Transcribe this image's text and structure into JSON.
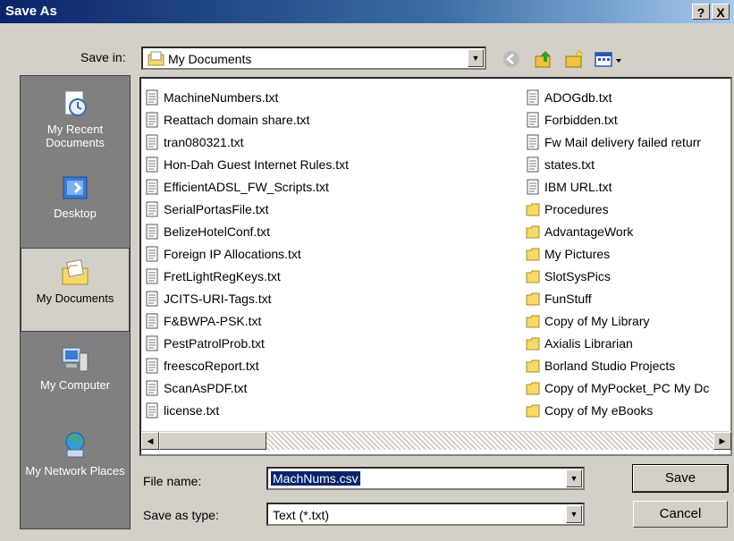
{
  "window": {
    "title": "Save As",
    "help_button": "?",
    "close_button": "X"
  },
  "toolbar": {
    "save_in_label": "Save in:",
    "save_in_value": "My Documents",
    "icons": [
      "back-icon",
      "up-folder-icon",
      "new-folder-icon",
      "views-menu-icon"
    ]
  },
  "places": [
    {
      "label": "My Recent Documents",
      "icon": "recent-documents-icon"
    },
    {
      "label": "Desktop",
      "icon": "desktop-icon"
    },
    {
      "label": "My Documents",
      "icon": "my-documents-icon",
      "selected": true
    },
    {
      "label": "My Computer",
      "icon": "my-computer-icon"
    },
    {
      "label": "My Network Places",
      "icon": "network-places-icon"
    }
  ],
  "files": {
    "column1": [
      {
        "name": "MachineNumbers.txt",
        "type": "file"
      },
      {
        "name": "Reattach domain share.txt",
        "type": "file"
      },
      {
        "name": "tran080321.txt",
        "type": "file"
      },
      {
        "name": "Hon-Dah Guest Internet Rules.txt",
        "type": "file"
      },
      {
        "name": "EfficientADSL_FW_Scripts.txt",
        "type": "file"
      },
      {
        "name": "SerialPortasFile.txt",
        "type": "file"
      },
      {
        "name": "BelizeHotelConf.txt",
        "type": "file"
      },
      {
        "name": "Foreign IP Allocations.txt",
        "type": "file"
      },
      {
        "name": "FretLightRegKeys.txt",
        "type": "file"
      },
      {
        "name": "JCITS-URI-Tags.txt",
        "type": "file"
      },
      {
        "name": "F&BWPA-PSK.txt",
        "type": "file"
      },
      {
        "name": "PestPatrolProb.txt",
        "type": "file"
      },
      {
        "name": "freescoReport.txt",
        "type": "file"
      },
      {
        "name": "ScanAsPDF.txt",
        "type": "file"
      },
      {
        "name": "license.txt",
        "type": "file"
      }
    ],
    "column2": [
      {
        "name": "ADOGdb.txt",
        "type": "file"
      },
      {
        "name": "Forbidden.txt",
        "type": "file"
      },
      {
        "name": "Fw Mail delivery failed returr",
        "type": "file"
      },
      {
        "name": "states.txt",
        "type": "file"
      },
      {
        "name": "IBM URL.txt",
        "type": "file"
      },
      {
        "name": "Procedures",
        "type": "folder"
      },
      {
        "name": "AdvantageWork",
        "type": "folder"
      },
      {
        "name": "My Pictures",
        "type": "folder"
      },
      {
        "name": "SlotSysPics",
        "type": "folder"
      },
      {
        "name": "FunStuff",
        "type": "folder"
      },
      {
        "name": "Copy of My Library",
        "type": "folder"
      },
      {
        "name": "Axialis Librarian",
        "type": "folder"
      },
      {
        "name": "Borland Studio Projects",
        "type": "folder"
      },
      {
        "name": "Copy of MyPocket_PC My Dc",
        "type": "folder"
      },
      {
        "name": "Copy of My eBooks",
        "type": "folder"
      }
    ]
  },
  "form": {
    "file_name_label": "File name:",
    "file_name_value": "MachNums.csv",
    "save_type_label": "Save as type:",
    "save_type_value": "Text (*.txt)",
    "save_button": "Save",
    "cancel_button": "Cancel"
  }
}
